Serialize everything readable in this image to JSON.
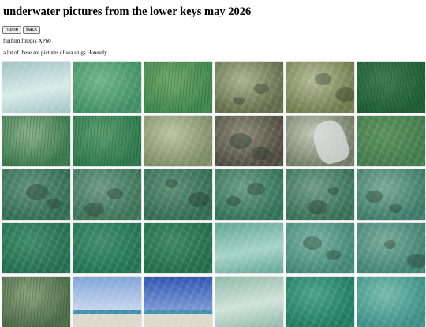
{
  "page": {
    "title": "underwater pictures from the lower keys may 2026",
    "camera": "fujifilm finepix XP60",
    "note": "a lot of these are pictures of sea slugs Honestly"
  },
  "nav": {
    "home_label": "home",
    "back_label": "back"
  },
  "gallery": [
    {
      "tone": "#9fc3c3",
      "tone2": "#d7ebe8",
      "kind": "surface"
    },
    {
      "tone": "#3e8e63",
      "tone2": "#6fb489",
      "kind": "water"
    },
    {
      "tone": "#3f8a4f",
      "tone2": "#75a86b",
      "kind": "grass"
    },
    {
      "tone": "#5f6a48",
      "tone2": "#a7b48c",
      "kind": "rock"
    },
    {
      "tone": "#6f7a4a",
      "tone2": "#b3b894",
      "kind": "rock"
    },
    {
      "tone": "#1e5d36",
      "tone2": "#3f7d52",
      "kind": "grass"
    },
    {
      "tone": "#3c7c4f",
      "tone2": "#8fb38e",
      "kind": "grass"
    },
    {
      "tone": "#2f7a4f",
      "tone2": "#5d9f70",
      "kind": "grass"
    },
    {
      "tone": "#7a8c62",
      "tone2": "#b8c3a1",
      "kind": "water"
    },
    {
      "tone": "#4c4a3c",
      "tone2": "#8a8875",
      "kind": "rock"
    },
    {
      "tone": "#6f7a63",
      "tone2": "#bfc7b4",
      "kind": "hand"
    },
    {
      "tone": "#3f7a4a",
      "tone2": "#5b8d5b",
      "kind": "water"
    },
    {
      "tone": "#2f6b52",
      "tone2": "#5e8f78",
      "kind": "rock"
    },
    {
      "tone": "#3a7256",
      "tone2": "#6c9880",
      "kind": "rock"
    },
    {
      "tone": "#2f6a50",
      "tone2": "#5e8d72",
      "kind": "rock"
    },
    {
      "tone": "#2f7058",
      "tone2": "#6b9a85",
      "kind": "rock"
    },
    {
      "tone": "#356e55",
      "tone2": "#6f9a86",
      "kind": "rock"
    },
    {
      "tone": "#3b7a66",
      "tone2": "#79a797",
      "kind": "rock"
    },
    {
      "tone": "#1f6d4d",
      "tone2": "#3d8a67",
      "kind": "water"
    },
    {
      "tone": "#1f7250",
      "tone2": "#3f8c69",
      "kind": "water"
    },
    {
      "tone": "#1e6b47",
      "tone2": "#3d8660",
      "kind": "water"
    },
    {
      "tone": "#5ea592",
      "tone2": "#a6d3c6",
      "kind": "surface"
    },
    {
      "tone": "#3f8670",
      "tone2": "#79b0a0",
      "kind": "rock"
    },
    {
      "tone": "#3e8270",
      "tone2": "#76a896",
      "kind": "rock"
    },
    {
      "tone": "#4e6d4b",
      "tone2": "#8fa47e",
      "kind": "grass"
    },
    {
      "tone": "#7fa3d8",
      "tone2": "#c9d8ef",
      "kind": "sky"
    },
    {
      "tone": "#2f55b0",
      "tone2": "#7e9ad6",
      "kind": "sky"
    },
    {
      "tone": "#8fb8a6",
      "tone2": "#cfe2d9",
      "kind": "surface"
    },
    {
      "tone": "#1d7a5f",
      "tone2": "#48a284",
      "kind": "water"
    },
    {
      "tone": "#3a8f84",
      "tone2": "#77b9ad",
      "kind": "water"
    }
  ]
}
